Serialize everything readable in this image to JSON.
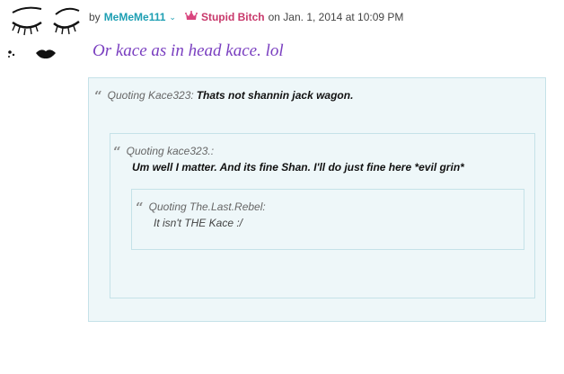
{
  "post": {
    "by_label": "by",
    "username": "MeMeMe111",
    "rank": "Stupid Bitch",
    "date": "on Jan. 1, 2014 at 10:09 PM",
    "text": "Or kace as in head kace. lol"
  },
  "quotes": {
    "outer": {
      "label": "Quoting Kace323:",
      "text": "Thats not shannin jack wagon."
    },
    "middle": {
      "label": "Quoting kace323.:",
      "text": "Um well I matter. And its fine Shan. I'll do just fine here *evil grin*"
    },
    "inner": {
      "label": "Quoting The.Last.Rebel:",
      "text": "It isn't THE Kace :/"
    }
  },
  "icons": {
    "quote_mark": "“",
    "chevron": "⌄"
  },
  "colors": {
    "username": "#1e9fb3",
    "rank": "#c8386b",
    "post_text": "#7a3fc0",
    "quote_bg": "#eef7f9",
    "quote_border": "#c5e2e8"
  }
}
